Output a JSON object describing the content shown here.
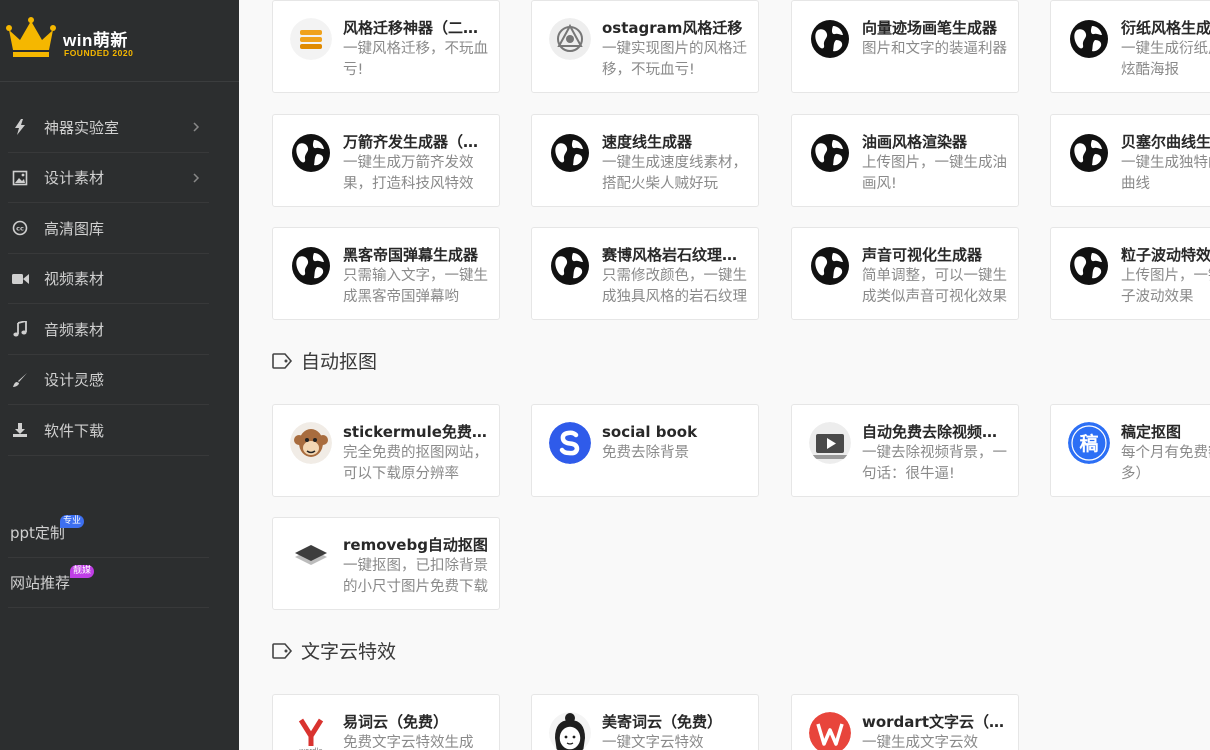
{
  "logo": {
    "name": "win萌新",
    "sub": "FOUNDED 2020",
    "color": "#f5b700"
  },
  "sidebar": {
    "items": [
      {
        "label": "神器实验室",
        "icon": "bolt-icon",
        "arrow": true
      },
      {
        "label": "设计素材",
        "icon": "image-icon",
        "arrow": true
      },
      {
        "label": "高清图库",
        "icon": "cc-icon",
        "arrow": false
      },
      {
        "label": "视频素材",
        "icon": "video-icon",
        "arrow": false
      },
      {
        "label": "音频素材",
        "icon": "music-icon",
        "arrow": false
      },
      {
        "label": "设计灵感",
        "icon": "brush-icon",
        "arrow": false
      },
      {
        "label": "软件下载",
        "icon": "download-icon",
        "arrow": false
      }
    ],
    "extras": [
      {
        "label": "ppt定制",
        "badge": "专业",
        "badge_color": "#3d6ff0"
      },
      {
        "label": "网站推荐",
        "badge": "靓媒",
        "badge_color": "#c03ee6"
      }
    ]
  },
  "cards_top": [
    {
      "title": "风格迁移神器（二次元）",
      "desc": "一键风格迁移，不玩血亏!",
      "icon": "orange-stack-icon"
    },
    {
      "title": "ostagram风格迁移",
      "desc": "一键实现图片的风格迁移，不玩血亏!",
      "icon": "ostagram-logo-icon"
    },
    {
      "title": "向量迹场画笔生成器",
      "desc": "图片和文字的装逼利器",
      "icon": "globe-icon"
    },
    {
      "title": "衍纸风格生成器",
      "desc": "一键生成衍纸风格，出炫酷海报",
      "icon": "globe-icon"
    },
    {
      "title": "万箭齐发生成器（数据）",
      "desc": "一键生成万箭齐发效果，打造科技风特效",
      "icon": "globe-icon"
    },
    {
      "title": "速度线生成器",
      "desc": "一键生成速度线素材，搭配火柴人贼好玩",
      "icon": "globe-icon"
    },
    {
      "title": "油画风格渲染器",
      "desc": "上传图片，一键生成油画风!",
      "icon": "globe-icon"
    },
    {
      "title": "贝塞尔曲线生成器",
      "desc": "一键生成独特的贝塞尔曲线",
      "icon": "globe-icon"
    },
    {
      "title": "黑客帝国弹幕生成器",
      "desc": "只需输入文字，一键生成黑客帝国弹幕哟",
      "icon": "globe-icon"
    },
    {
      "title": "赛博风格岩石纹理生成器",
      "desc": "只需修改颜色，一键生成独具风格的岩石纹理",
      "icon": "globe-icon"
    },
    {
      "title": "声音可视化生成器",
      "desc": "简单调整，可以一键生成类似声音可视化效果",
      "icon": "globe-icon"
    },
    {
      "title": "粒子波动特效生成器",
      "desc": "上传图片，一键生成粒子波动效果",
      "icon": "globe-icon"
    }
  ],
  "section_cutout": {
    "title": "自动抠图"
  },
  "cards_cutout": [
    {
      "title": "stickermule免费抠图",
      "desc": "完全免费的抠图网站，可以下载原分辨率",
      "icon": "monkey-icon"
    },
    {
      "title": "social book",
      "desc": "免费去除背景",
      "icon": "socialbook-s-icon"
    },
    {
      "title": "自动免费去除视频背景",
      "desc": "一键去除视频背景，一句话：很牛逼!",
      "icon": "video-play-icon"
    },
    {
      "title": "稿定抠图",
      "desc": "每个月有免费额度（不多）",
      "icon": "gaoding-icon"
    },
    {
      "title": "removebg自动抠图",
      "desc": "一键抠图，已扣除背景的小尺寸图片免费下载",
      "icon": "layers-icon"
    }
  ],
  "section_wordcloud": {
    "title": "文字云特效"
  },
  "cards_wordcloud": [
    {
      "title": "易词云（免费）",
      "desc": "免费文字云特效生成",
      "icon": "wordle-y-icon"
    },
    {
      "title": "美寄词云（免费）",
      "desc": "一键文字云特效",
      "icon": "girl-avatar-icon"
    },
    {
      "title": "wordart文字云（收费）",
      "desc": "一键生成文字云效",
      "icon": "wordart-w-icon"
    }
  ]
}
